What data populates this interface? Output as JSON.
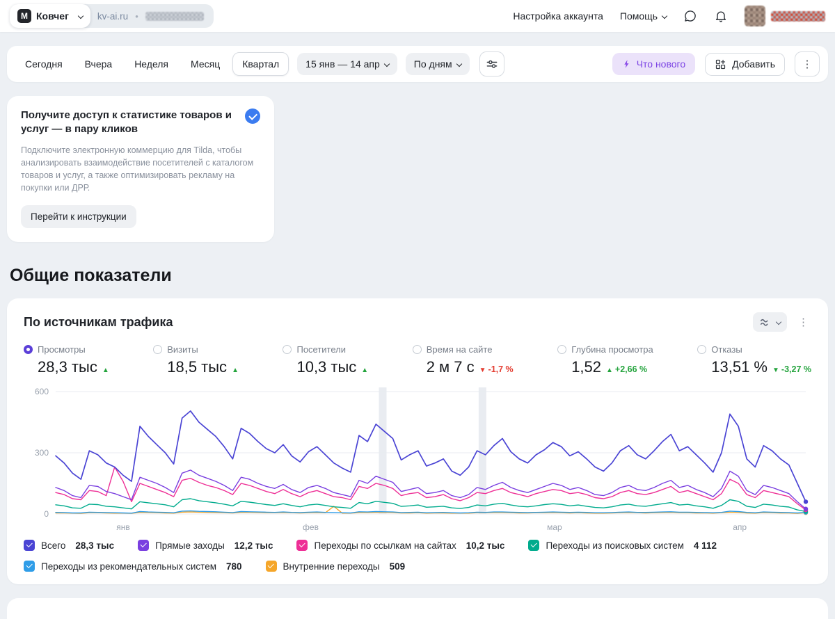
{
  "header": {
    "workspace": "Ковчег",
    "site": "kv-ai.ru",
    "separator": "•",
    "account_settings": "Настройка аккаунта",
    "help": "Помощь"
  },
  "toolbar": {
    "periods": [
      "Сегодня",
      "Вчера",
      "Неделя",
      "Месяц",
      "Квартал"
    ],
    "selected_period": "Квартал",
    "date_range": "15 янв — 14 апр",
    "granularity": "По дням",
    "whats_new_label": "Что нового",
    "add_label": "Добавить"
  },
  "promo": {
    "title": "Получите доступ к статистике товаров и услуг — в пару кликов",
    "description": "Подключите электронную коммерцию для Tilda, чтобы анализировать взаимодействие посетителей с каталогом товаров и услуг, а также оптимизировать рекламу на покупки или ДРР.",
    "button": "Перейти к инструкции"
  },
  "section_title": "Общие показатели",
  "traffic_card": {
    "title": "По источникам трафика",
    "metrics": [
      {
        "label": "Просмотры",
        "value": "28,3 тыс",
        "arrow": "▲",
        "arrow_color": "#23a33c",
        "delta": "",
        "selected": true
      },
      {
        "label": "Визиты",
        "value": "18,5 тыс",
        "arrow": "▲",
        "arrow_color": "#23a33c",
        "delta": ""
      },
      {
        "label": "Посетители",
        "value": "10,3 тыс",
        "arrow": "▲",
        "arrow_color": "#23a33c",
        "delta": ""
      },
      {
        "label": "Время на сайте",
        "value": "2 м 7 с",
        "arrow": "▼",
        "arrow_color": "#e33a2e",
        "delta": "-1,7 %",
        "delta_color": "#e33a2e"
      },
      {
        "label": "Глубина просмотра",
        "value": "1,52",
        "arrow": "▲",
        "arrow_color": "#23a33c",
        "delta": "+2,66 %",
        "delta_color": "#23a33c"
      },
      {
        "label": "Отказы",
        "value": "13,51 %",
        "arrow": "▼",
        "arrow_color": "#23a33c",
        "delta": "-3,27 %",
        "delta_color": "#23a33c"
      }
    ]
  },
  "chart_data": {
    "type": "line",
    "title": "По источникам трафика",
    "x_range": "15 янв — 14 апр",
    "granularity": "По дням",
    "ylim": [
      0,
      600
    ],
    "yticks": [
      0,
      300,
      600
    ],
    "grid": true,
    "legend_position": "bottom",
    "x_months": [
      {
        "label": "янв",
        "frac": 0.09
      },
      {
        "label": "фев",
        "frac": 0.34
      },
      {
        "label": "мар",
        "frac": 0.665
      },
      {
        "label": "апр",
        "frac": 0.912
      }
    ],
    "highlight_band_fracs": [
      0.436,
      0.569
    ],
    "series": [
      {
        "name": "Всего",
        "total": "28,3 тыс",
        "color": "#4a44d4",
        "width": 1.7,
        "values": [
          285,
          250,
          200,
          170,
          310,
          290,
          250,
          230,
          190,
          160,
          430,
          380,
          340,
          300,
          245,
          470,
          505,
          450,
          415,
          380,
          330,
          270,
          420,
          395,
          355,
          320,
          300,
          340,
          285,
          255,
          305,
          330,
          290,
          250,
          225,
          205,
          385,
          355,
          440,
          405,
          370,
          265,
          290,
          310,
          235,
          250,
          270,
          210,
          190,
          230,
          310,
          290,
          335,
          370,
          305,
          270,
          250,
          290,
          315,
          350,
          330,
          285,
          305,
          270,
          230,
          210,
          250,
          310,
          335,
          290,
          270,
          310,
          355,
          390,
          310,
          330,
          290,
          250,
          205,
          300,
          490,
          430,
          270,
          230,
          335,
          310,
          270,
          240,
          150,
          60
        ]
      },
      {
        "name": "Прямые заходы",
        "total": "12,2 тыс",
        "color": "#7a3fe0",
        "width": 1.4,
        "values": [
          130,
          115,
          90,
          80,
          140,
          135,
          110,
          100,
          85,
          70,
          180,
          165,
          150,
          130,
          105,
          200,
          215,
          190,
          175,
          160,
          140,
          115,
          180,
          170,
          150,
          135,
          125,
          145,
          120,
          105,
          130,
          140,
          125,
          105,
          95,
          85,
          165,
          150,
          185,
          170,
          155,
          110,
          120,
          130,
          100,
          105,
          115,
          90,
          80,
          95,
          130,
          120,
          140,
          155,
          130,
          115,
          105,
          120,
          135,
          150,
          140,
          120,
          130,
          115,
          95,
          90,
          105,
          130,
          140,
          120,
          115,
          130,
          150,
          165,
          130,
          140,
          120,
          105,
          85,
          125,
          210,
          185,
          115,
          95,
          140,
          130,
          115,
          100,
          60,
          25
        ]
      },
      {
        "name": "Переходы по ссылкам на сайтах",
        "total": "10,2 тыс",
        "color": "#ee2f96",
        "width": 1.4,
        "values": [
          105,
          95,
          75,
          70,
          115,
          110,
          90,
          230,
          160,
          60,
          150,
          135,
          120,
          105,
          85,
          165,
          175,
          155,
          140,
          130,
          115,
          95,
          150,
          140,
          125,
          110,
          100,
          120,
          100,
          85,
          105,
          115,
          100,
          85,
          80,
          70,
          135,
          125,
          150,
          140,
          125,
          90,
          100,
          105,
          80,
          85,
          95,
          75,
          65,
          80,
          105,
          100,
          115,
          125,
          105,
          95,
          85,
          100,
          110,
          120,
          115,
          100,
          105,
          95,
          80,
          75,
          85,
          105,
          115,
          100,
          95,
          105,
          120,
          135,
          105,
          115,
          100,
          85,
          70,
          100,
          170,
          150,
          95,
          80,
          115,
          105,
          95,
          85,
          50,
          20
        ]
      },
      {
        "name": "Переходы из поисковых систем",
        "total": "4 112",
        "color": "#00ab8d",
        "width": 1.4,
        "values": [
          45,
          40,
          30,
          28,
          48,
          46,
          38,
          35,
          30,
          25,
          60,
          55,
          50,
          45,
          35,
          70,
          75,
          65,
          60,
          55,
          48,
          40,
          62,
          58,
          52,
          46,
          42,
          50,
          42,
          35,
          44,
          48,
          42,
          35,
          32,
          28,
          56,
          50,
          62,
          57,
          52,
          37,
          40,
          44,
          33,
          35,
          38,
          30,
          27,
          32,
          44,
          40,
          48,
          52,
          44,
          38,
          35,
          40,
          46,
          50,
          47,
          40,
          44,
          38,
          32,
          30,
          35,
          44,
          48,
          40,
          38,
          44,
          50,
          56,
          44,
          47,
          40,
          35,
          28,
          42,
          70,
          62,
          38,
          32,
          48,
          44,
          38,
          34,
          20,
          12
        ]
      },
      {
        "name": "Переходы из рекомендательных систем",
        "total": "780",
        "color": "#2f9de8",
        "width": 1.4,
        "values": [
          8,
          7,
          5,
          5,
          9,
          8,
          7,
          6,
          5,
          4,
          12,
          10,
          9,
          8,
          6,
          14,
          15,
          13,
          12,
          11,
          9,
          7,
          12,
          11,
          10,
          9,
          8,
          10,
          8,
          7,
          9,
          10,
          8,
          7,
          6,
          5,
          11,
          10,
          12,
          11,
          10,
          7,
          8,
          9,
          6,
          7,
          8,
          6,
          5,
          6,
          9,
          8,
          10,
          10,
          9,
          8,
          7,
          8,
          9,
          10,
          9,
          8,
          9,
          8,
          6,
          6,
          7,
          9,
          10,
          8,
          8,
          9,
          10,
          11,
          9,
          9,
          8,
          7,
          6,
          8,
          14,
          12,
          8,
          6,
          10,
          9,
          8,
          7,
          5,
          8
        ]
      },
      {
        "name": "Внутренние переходы",
        "total": "509",
        "color": "#f5a62a",
        "width": 1.4,
        "values": [
          5,
          5,
          4,
          3,
          6,
          6,
          5,
          4,
          4,
          3,
          8,
          7,
          6,
          5,
          4,
          9,
          10,
          9,
          8,
          7,
          6,
          5,
          8,
          8,
          7,
          6,
          6,
          7,
          6,
          5,
          6,
          7,
          6,
          38,
          4,
          4,
          7,
          7,
          8,
          8,
          7,
          5,
          5,
          6,
          4,
          5,
          5,
          4,
          4,
          4,
          6,
          6,
          7,
          7,
          6,
          5,
          5,
          6,
          6,
          7,
          6,
          5,
          6,
          5,
          4,
          4,
          5,
          6,
          7,
          6,
          5,
          6,
          7,
          8,
          6,
          6,
          5,
          5,
          4,
          6,
          9,
          8,
          5,
          4,
          7,
          6,
          5,
          5,
          3,
          6
        ]
      }
    ]
  }
}
